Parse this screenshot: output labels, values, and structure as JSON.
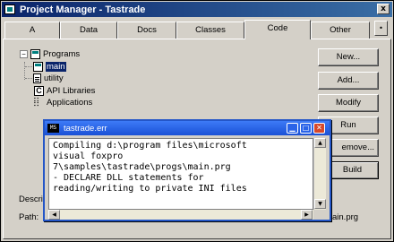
{
  "window": {
    "title": "Project Manager - Tastrade",
    "close_label": "x"
  },
  "tabs": [
    {
      "label": "A",
      "active": false
    },
    {
      "label": "Data",
      "active": false
    },
    {
      "label": "Docs",
      "active": false
    },
    {
      "label": "Classes",
      "active": false
    },
    {
      "label": "Code",
      "active": true
    },
    {
      "label": "Other",
      "active": false
    }
  ],
  "tab_scroll_label": "•",
  "tree": {
    "programs_label": "Programs",
    "programs_expander": "−",
    "main_label": "main",
    "utility_label": "utility",
    "api_label": "API Libraries",
    "apps_label": "Applications"
  },
  "buttons": {
    "new": "New...",
    "add": "Add...",
    "modify": "Modify",
    "run": "Run",
    "remove": "emove...",
    "build": "Build"
  },
  "bottom": {
    "description_label": "Descri",
    "path_label": "Path:",
    "path_value_tail": "ain.prg"
  },
  "popup": {
    "icon_text": "MS",
    "title": "tastrade.err",
    "lines": [
      "Compiling d:\\program files\\microsoft",
      "visual foxpro",
      "7\\samples\\tastrade\\progs\\main.prg",
      "- DECLARE DLL statements for",
      "reading/writing to private INI files"
    ]
  },
  "colors": {
    "titlebar": "#0a246a",
    "popup_titlebar": "#1a50d6",
    "face": "#d4d0c8",
    "selection": "#0a246a"
  }
}
